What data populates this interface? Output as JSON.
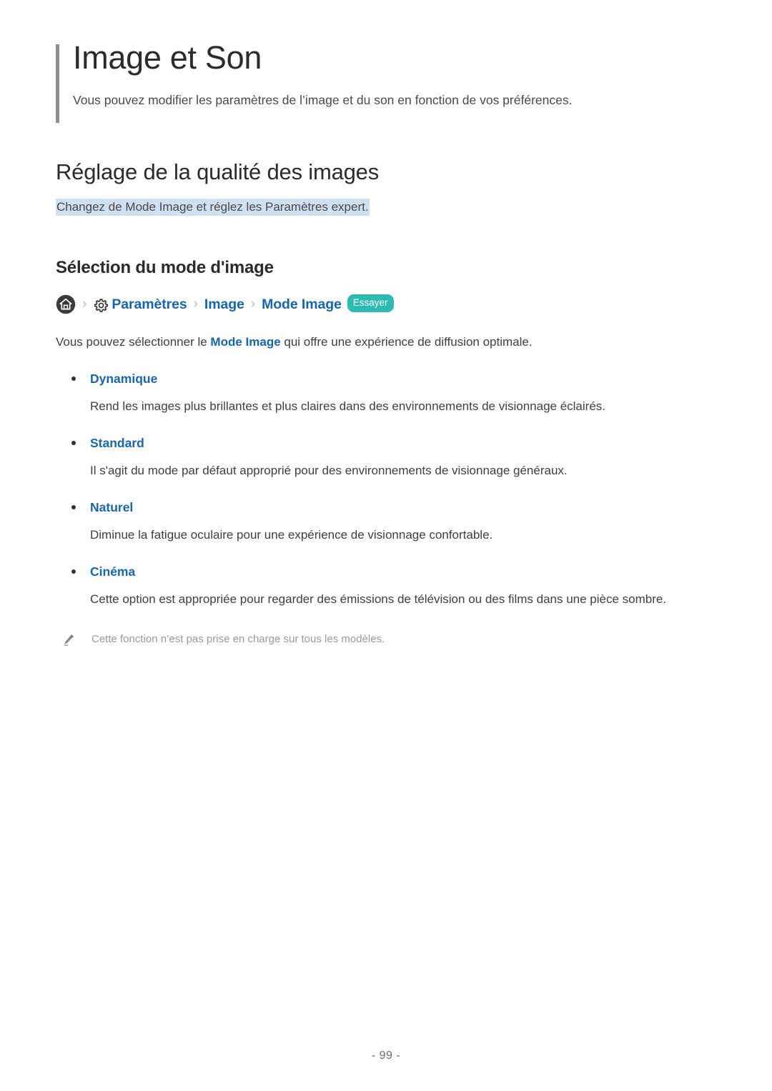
{
  "document": {
    "title": "Image et Son",
    "subtitle": "Vous pouvez modifier les paramètres de l’image et du son en fonction de vos préférences.",
    "page_number": "- 99 -"
  },
  "section": {
    "heading": "Réglage de la qualité des images",
    "description_highlighted": "Changez de Mode Image et réglez les Paramètres expert."
  },
  "subsection": {
    "heading": "Sélection du mode d'image",
    "breadcrumb": {
      "home_icon": "home-icon",
      "gear_icon": "gear-icon",
      "separator": "›",
      "items": [
        {
          "label": "Paramètres"
        },
        {
          "label": "Image"
        },
        {
          "label": "Mode Image"
        }
      ],
      "try_badge": "Essayer"
    },
    "intro": {
      "before_link": "Vous pouvez sélectionner le ",
      "link": "Mode Image",
      "after_link": " qui offre une expérience de diffusion optimale."
    },
    "modes": [
      {
        "term": "Dynamique",
        "description": "Rend les images plus brillantes et plus claires dans des environnements de visionnage éclairés."
      },
      {
        "term": "Standard",
        "description": "Il s'agit du mode par défaut approprié pour des environnements de visionnage généraux."
      },
      {
        "term": "Naturel",
        "description": "Diminue la fatigue oculaire pour une expérience de visionnage confortable."
      },
      {
        "term": "Cinéma",
        "description": "Cette option est appropriée pour regarder des émissions de télévision ou des films dans une pièce sombre."
      }
    ],
    "footnote": {
      "icon": "pencil-icon",
      "text": "Cette fonction n’est pas prise en charge sur tous les modèles."
    }
  },
  "colors": {
    "link_blue": "#1666b4",
    "badge_teal": "#2bbbb3",
    "highlight_blue": "#cfe0f0",
    "accent_rule_gray": "#8e8e8e",
    "body_text": "#3f3f3f",
    "footnote_gray": "#9b9b9b"
  }
}
